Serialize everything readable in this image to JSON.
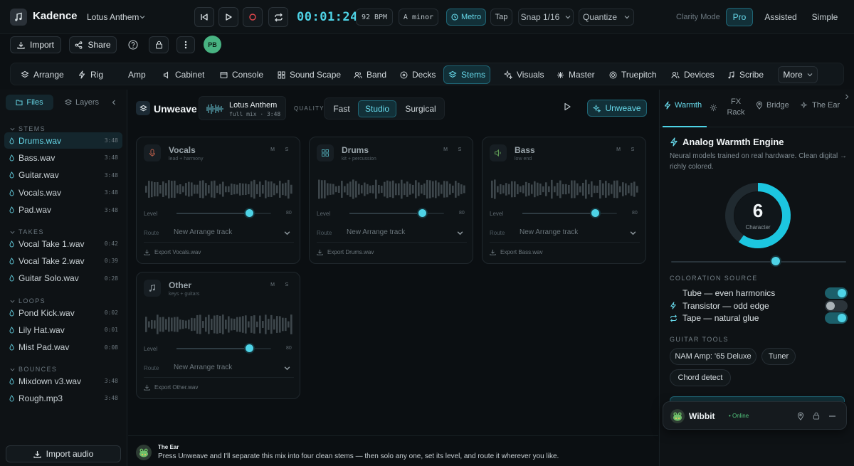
{
  "app": {
    "name": "Kadence",
    "project": "Lotus Anthem"
  },
  "transport": {
    "time": "00:01:24",
    "bpm": "92 BPM",
    "key": "A minor",
    "metro_label": "Metro",
    "tap_label": "Tap",
    "snap_label": "Snap 1/16",
    "quantize_label": "Quantize"
  },
  "clarity": {
    "label": "Clarity Mode",
    "modes": [
      "Pro",
      "Assisted",
      "Simple"
    ],
    "active": "Pro"
  },
  "toolbar": {
    "import_label": "Import",
    "share_label": "Share",
    "avatar_initials": "PB"
  },
  "nav": {
    "items": [
      "Arrange",
      "Rig",
      "Amp",
      "Cabinet",
      "Console",
      "Sound Scape",
      "Band",
      "Decks",
      "Stems",
      "Visuals",
      "Master",
      "Truepitch",
      "Devices",
      "Scribe"
    ],
    "active": "Stems",
    "more_label": "More"
  },
  "sidebar": {
    "tabs": [
      "Files",
      "Layers"
    ],
    "groups": [
      {
        "title": "STEMS",
        "files": [
          {
            "name": "Drums.wav",
            "dur": "3:48"
          },
          {
            "name": "Bass.wav",
            "dur": "3:48"
          },
          {
            "name": "Guitar.wav",
            "dur": "3:48"
          },
          {
            "name": "Vocals.wav",
            "dur": "3:48"
          },
          {
            "name": "Pad.wav",
            "dur": "3:48"
          }
        ]
      },
      {
        "title": "TAKES",
        "files": [
          {
            "name": "Vocal Take 1.wav",
            "dur": "0:42"
          },
          {
            "name": "Vocal Take 2.wav",
            "dur": "0:39"
          },
          {
            "name": "Guitar Solo.wav",
            "dur": "0:28"
          }
        ]
      },
      {
        "title": "LOOPS",
        "files": [
          {
            "name": "Pond Kick.wav",
            "dur": "0:02"
          },
          {
            "name": "Lily Hat.wav",
            "dur": "0:01"
          },
          {
            "name": "Mist Pad.wav",
            "dur": "0:08"
          }
        ]
      },
      {
        "title": "BOUNCES",
        "files": [
          {
            "name": "Mixdown v3.wav",
            "dur": "3:48"
          },
          {
            "name": "Rough.mp3",
            "dur": "3:48"
          }
        ]
      }
    ],
    "import_audio_label": "Import audio"
  },
  "unweave": {
    "title": "Unweave",
    "track": {
      "title": "Lotus Anthem",
      "sub": "full mix · 3:48"
    },
    "quality_label": "QUALITY",
    "quality_options": [
      "Fast",
      "Studio",
      "Surgical"
    ],
    "quality_active": "Studio",
    "button_label": "Unweave",
    "stems": [
      {
        "name": "Vocals",
        "sub": "lead + harmony",
        "level": "80",
        "route": "New Arrange track",
        "export": "Export Vocals.wav"
      },
      {
        "name": "Drums",
        "sub": "kit + percussion",
        "level": "80",
        "route": "New Arrange track",
        "export": "Export Drums.wav"
      },
      {
        "name": "Bass",
        "sub": "low end",
        "level": "80",
        "route": "New Arrange track",
        "export": "Export Bass.wav"
      },
      {
        "name": "Other",
        "sub": "keys + guitars",
        "level": "80",
        "route": "New Arrange track",
        "export": "Export Other.wav"
      }
    ],
    "stem_labels": {
      "mute": "M",
      "solo": "S",
      "level": "Level",
      "route": "Route"
    },
    "ear": {
      "title": "The Ear",
      "message": "Press Unweave and I'll separate this mix into four clean stems — then solo any one, set its level, and route it wherever you like."
    }
  },
  "panel": {
    "tabs": [
      "Warmth",
      "FX Rack",
      "Bridge",
      "The Ear"
    ],
    "active": "Warmth",
    "title": "Analog Warmth Engine",
    "desc": "Neural models trained on real hardware. Clean digital → richly colored.",
    "character_value": "6",
    "character_label": "Character",
    "character_fraction": 0.6,
    "coloration_title": "COLORATION SOURCE",
    "sources": [
      {
        "label": "Tube — even harmonics",
        "on": true
      },
      {
        "label": "Transistor — odd edge",
        "on": false
      },
      {
        "label": "Tape — natural glue",
        "on": true
      }
    ],
    "guitar_title": "GUITAR TOOLS",
    "guitar_tools": [
      "NAM Amp: '65 Deluxe",
      "Tuner",
      "Chord detect"
    ]
  },
  "wibbit": {
    "name": "Wibbit",
    "status": "• Online"
  },
  "colors": {
    "accent": "#4ed3e6",
    "accent_bg": "#123038",
    "online": "#52c47c"
  }
}
